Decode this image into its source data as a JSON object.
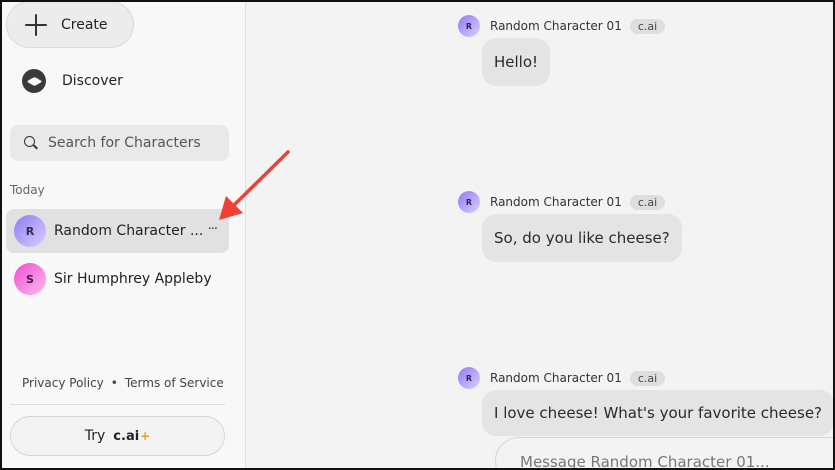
{
  "sidebar": {
    "create_label": "Create",
    "discover_label": "Discover",
    "search_placeholder": "Search for Characters",
    "section_label": "Today",
    "chats": [
      {
        "initial": "R",
        "name": "Random Character ...",
        "more": "···",
        "active": true
      },
      {
        "initial": "S",
        "name": "Sir Humphrey Appleby",
        "active": false
      }
    ],
    "footer": {
      "privacy": "Privacy Policy",
      "separator": "•",
      "terms": "Terms of Service"
    },
    "try_button": {
      "prefix": "Try",
      "brand": "c.ai",
      "plus": "+"
    }
  },
  "messages": [
    {
      "initial": "R",
      "author": "Random Character 01",
      "badge": "c.ai",
      "text": "Hello!"
    },
    {
      "initial": "R",
      "author": "Random Character 01",
      "badge": "c.ai",
      "text": "So, do you like cheese?"
    },
    {
      "initial": "R",
      "author": "Random Character 01",
      "badge": "c.ai",
      "text": "I love cheese! What's your favorite cheese?"
    }
  ],
  "composer": {
    "placeholder": "Message Random Character 01..."
  },
  "annotation": {
    "arrow_color": "#ef4034"
  }
}
